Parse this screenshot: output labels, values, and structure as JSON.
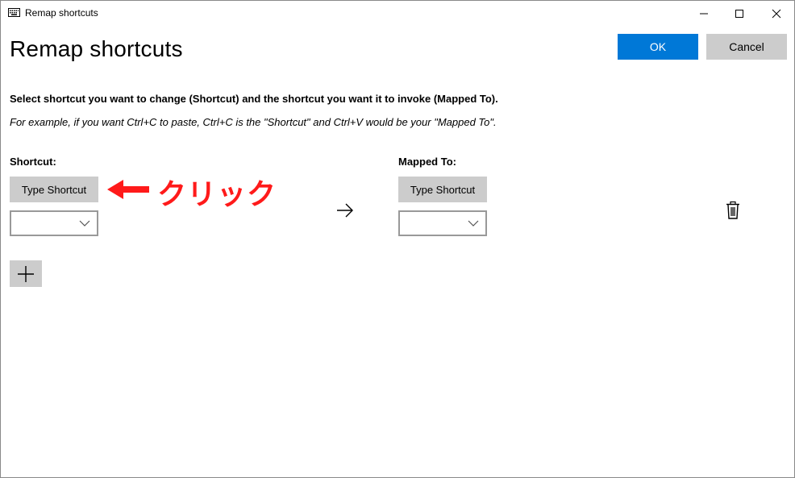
{
  "window": {
    "title": "Remap shortcuts",
    "icon": "keyboard-icon",
    "controls": [
      "minimize-icon",
      "maximize-icon",
      "close-icon"
    ]
  },
  "header": {
    "title": "Remap shortcuts",
    "ok_label": "OK",
    "cancel_label": "Cancel"
  },
  "instructions": {
    "description": "Select shortcut you want to change (Shortcut) and the shortcut you want it to invoke (Mapped To).",
    "example": "For example, if you want Ctrl+C to paste, Ctrl+C is the \"Shortcut\" and Ctrl+V would be your \"Mapped To\"."
  },
  "rows": [
    {
      "shortcut_label": "Shortcut:",
      "shortcut_button": "Type Shortcut",
      "shortcut_value": "",
      "mapped_label": "Mapped To:",
      "mapped_button": "Type Shortcut",
      "mapped_value": ""
    }
  ],
  "annotation": {
    "text": "クリック",
    "color": "#ff1a1a"
  },
  "colors": {
    "accent": "#0078d7",
    "button_gray": "#cccccc"
  }
}
